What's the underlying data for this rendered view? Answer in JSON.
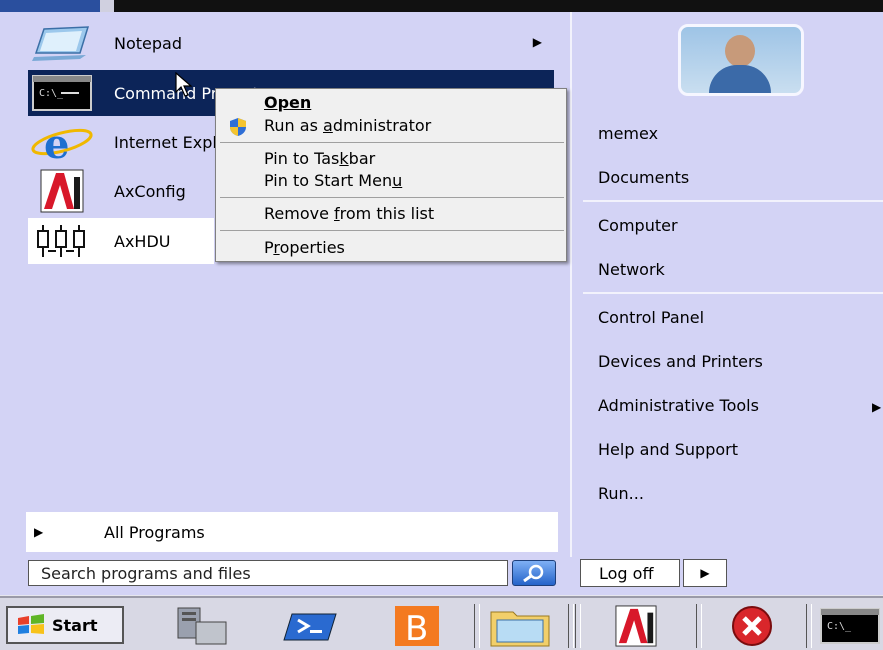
{
  "start_menu": {
    "programs": [
      {
        "label": "Notepad",
        "icon": "notepad-icon",
        "has_submenu": true
      },
      {
        "label": "Command Prompt",
        "icon": "cmd-icon",
        "selected": true
      },
      {
        "label": "Internet Explorer",
        "icon": "internet-explorer-icon"
      },
      {
        "label": "AxConfig",
        "icon": "axconfig-icon"
      },
      {
        "label": "AxHDU",
        "icon": "axhdu-icon"
      }
    ],
    "all_programs": "All Programs",
    "search_placeholder": "Search programs and files",
    "right_items": [
      "memex",
      "Documents",
      "Computer",
      "Network",
      "Control Panel",
      "Devices and Printers",
      "Administrative Tools",
      "Help and Support",
      "Run..."
    ],
    "log_off": "Log off"
  },
  "context_menu": {
    "open": "Open",
    "run_as_admin_pre": "Run as ",
    "run_as_admin_u": "a",
    "run_as_admin_post": "dministrator",
    "pin_taskbar_pre": "Pin to Tas",
    "pin_taskbar_u": "k",
    "pin_taskbar_post": "bar",
    "pin_start_pre": "Pin to Start Men",
    "pin_start_u": "u",
    "remove_pre": "Remove ",
    "remove_u": "f",
    "remove_post": "rom this list",
    "props_pre": "P",
    "props_u": "r",
    "props_post": "operties"
  },
  "taskbar": {
    "start_label": "Start",
    "icons": [
      "server-manager-icon",
      "powershell-icon",
      "b-app-icon",
      "explorer-folder-icon",
      "axconfig-icon",
      "error-icon",
      "cmd-icon"
    ]
  },
  "colors": {
    "menu_bg": "#d3d3f5",
    "selection": "#0c2458"
  }
}
